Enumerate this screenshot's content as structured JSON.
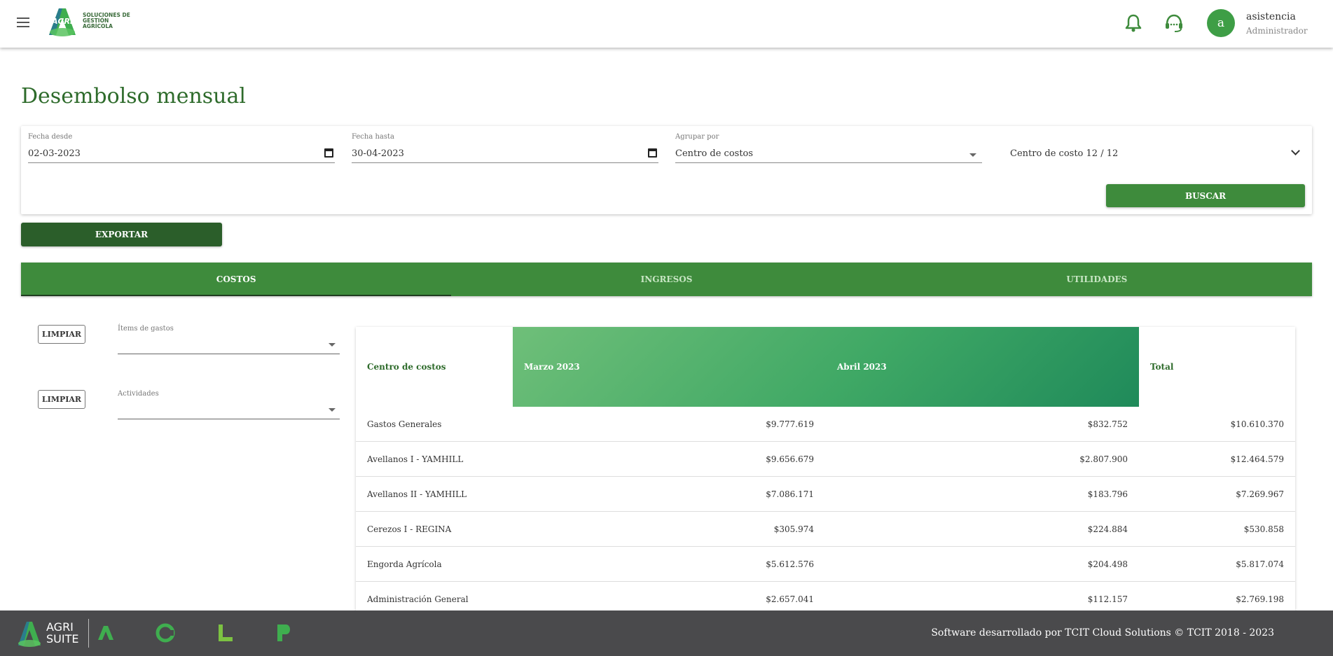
{
  "header": {
    "logo_text": "AGRI",
    "logo_subtitle": "SOLUCIONES DE GESTIÓN AGRÍCOLA",
    "user_initial": "a",
    "user_name": "asistencia",
    "user_role": "Administrador"
  },
  "page_title": "Desembolso mensual",
  "filters": {
    "fecha_desde_label": "Fecha desde",
    "fecha_desde_value": "02-03-2023",
    "fecha_hasta_label": "Fecha hasta",
    "fecha_hasta_value": "30-04-2023",
    "agrupar_label": "Agrupar por",
    "agrupar_value": "Centro de costos",
    "centro_value": "Centro de costo 12 / 12",
    "buscar_label": "BUSCAR"
  },
  "exportar_label": "EXPORTAR",
  "tabs": [
    {
      "label": "COSTOS",
      "active": true
    },
    {
      "label": "INGRESOS",
      "active": false
    },
    {
      "label": "UTILIDADES",
      "active": false
    }
  ],
  "side_filters": {
    "limpiar_label": "LIMPIAR",
    "items_label": "Ítems de gastos",
    "actividades_label": "Actividades"
  },
  "table": {
    "headers": {
      "centro": "Centro de costos",
      "month1": "Marzo 2023",
      "month2": "Abril 2023",
      "total": "Total"
    },
    "rows": [
      {
        "name": "Gastos Generales",
        "m1": "$9.777.619",
        "m2": "$832.752",
        "total": "$10.610.370"
      },
      {
        "name": "Avellanos I - YAMHILL",
        "m1": "$9.656.679",
        "m2": "$2.807.900",
        "total": "$12.464.579"
      },
      {
        "name": "Avellanos II - YAMHILL",
        "m1": "$7.086.171",
        "m2": "$183.796",
        "total": "$7.269.967"
      },
      {
        "name": "Cerezos I - REGINA",
        "m1": "$305.974",
        "m2": "$224.884",
        "total": "$530.858"
      },
      {
        "name": "Engorda Agrícola",
        "m1": "$5.612.576",
        "m2": "$204.498",
        "total": "$5.817.074"
      },
      {
        "name": "Administración General",
        "m1": "$2.657.041",
        "m2": "$112.157",
        "total": "$2.769.198"
      }
    ]
  },
  "footer": {
    "brand_line1": "AGRI",
    "brand_line2": "SUITE",
    "text": "Software desarrollado por TCIT Cloud Solutions © TCIT 2018 - 2023"
  },
  "colors": {
    "primary": "#3e8b3c",
    "dark_green": "#2b5e2a",
    "title_green": "#2e6b2b",
    "footer_bg": "#4a4a4c"
  }
}
